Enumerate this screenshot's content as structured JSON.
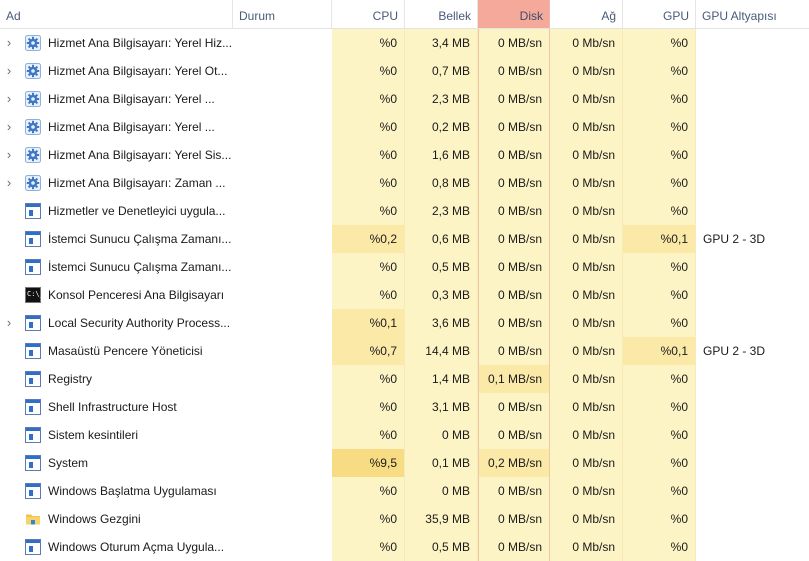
{
  "header": {
    "name": "Ad",
    "status": "Durum",
    "cpu": "CPU",
    "memory": "Bellek",
    "disk": "Disk",
    "network": "Ağ",
    "gpu": "GPU",
    "gpu_engine": "GPU Altyapısı"
  },
  "colors": {
    "light": "#fdf4c5",
    "medium": "#fbe9a8",
    "strong": "#f8dc83",
    "disk_header": "#f4a99a"
  },
  "rows": [
    {
      "name": "Hizmet Ana Bilgisayarı: Yerel Hiz...",
      "icon": "gear-icon",
      "expand": true,
      "cpu": "%0",
      "memory": "3,4 MB",
      "disk": "0 MB/sn",
      "network": "0 Mb/sn",
      "gpu": "%0",
      "engine": ""
    },
    {
      "name": "Hizmet Ana Bilgisayarı: Yerel Ot...",
      "icon": "gear-icon",
      "expand": true,
      "cpu": "%0",
      "memory": "0,7 MB",
      "disk": "0 MB/sn",
      "network": "0 Mb/sn",
      "gpu": "%0",
      "engine": ""
    },
    {
      "name": "Hizmet Ana Bilgisayarı: Yerel ...",
      "icon": "gear-icon",
      "expand": true,
      "cpu": "%0",
      "memory": "2,3 MB",
      "disk": "0 MB/sn",
      "network": "0 Mb/sn",
      "gpu": "%0",
      "engine": ""
    },
    {
      "name": "Hizmet Ana Bilgisayarı: Yerel ...",
      "icon": "gear-icon",
      "expand": true,
      "cpu": "%0",
      "memory": "0,2 MB",
      "disk": "0 MB/sn",
      "network": "0 Mb/sn",
      "gpu": "%0",
      "engine": ""
    },
    {
      "name": "Hizmet Ana Bilgisayarı: Yerel Sis...",
      "icon": "gear-icon",
      "expand": true,
      "cpu": "%0",
      "memory": "1,6 MB",
      "disk": "0 MB/sn",
      "network": "0 Mb/sn",
      "gpu": "%0",
      "engine": ""
    },
    {
      "name": "Hizmet Ana Bilgisayarı: Zaman ...",
      "icon": "gear-icon",
      "expand": true,
      "cpu": "%0",
      "memory": "0,8 MB",
      "disk": "0 MB/sn",
      "network": "0 Mb/sn",
      "gpu": "%0",
      "engine": ""
    },
    {
      "name": "Hizmetler ve Denetleyici uygula...",
      "icon": "window-app-icon",
      "expand": false,
      "cpu": "%0",
      "memory": "2,3 MB",
      "disk": "0 MB/sn",
      "network": "0 Mb/sn",
      "gpu": "%0",
      "engine": ""
    },
    {
      "name": "İstemci Sunucu Çalışma Zamanı...",
      "icon": "window-app-icon",
      "expand": false,
      "cpu": "%0,2",
      "memory": "0,6 MB",
      "disk": "0 MB/sn",
      "network": "0 Mb/sn",
      "gpu": "%0,1",
      "engine": "GPU 2 - 3D",
      "hl_cpu": "medium",
      "hl_gpu": "medium"
    },
    {
      "name": "İstemci Sunucu Çalışma Zamanı...",
      "icon": "window-app-icon",
      "expand": false,
      "cpu": "%0",
      "memory": "0,5 MB",
      "disk": "0 MB/sn",
      "network": "0 Mb/sn",
      "gpu": "%0",
      "engine": ""
    },
    {
      "name": "Konsol Penceresi Ana Bilgisayarı",
      "icon": "console-icon",
      "expand": false,
      "cpu": "%0",
      "memory": "0,3 MB",
      "disk": "0 MB/sn",
      "network": "0 Mb/sn",
      "gpu": "%0",
      "engine": ""
    },
    {
      "name": "Local Security Authority Process...",
      "icon": "window-app-icon",
      "expand": true,
      "cpu": "%0,1",
      "memory": "3,6 MB",
      "disk": "0 MB/sn",
      "network": "0 Mb/sn",
      "gpu": "%0",
      "engine": "",
      "hl_cpu": "medium"
    },
    {
      "name": "Masaüstü Pencere Yöneticisi",
      "icon": "window-app-icon",
      "expand": false,
      "cpu": "%0,7",
      "memory": "14,4 MB",
      "disk": "0 MB/sn",
      "network": "0 Mb/sn",
      "gpu": "%0,1",
      "engine": "GPU 2 - 3D",
      "hl_cpu": "medium",
      "hl_gpu": "medium"
    },
    {
      "name": "Registry",
      "icon": "window-app-icon",
      "expand": false,
      "cpu": "%0",
      "memory": "1,4 MB",
      "disk": "0,1 MB/sn",
      "network": "0 Mb/sn",
      "gpu": "%0",
      "engine": "",
      "hl_disk": "medium"
    },
    {
      "name": "Shell Infrastructure Host",
      "icon": "window-app-icon",
      "expand": false,
      "cpu": "%0",
      "memory": "3,1 MB",
      "disk": "0 MB/sn",
      "network": "0 Mb/sn",
      "gpu": "%0",
      "engine": ""
    },
    {
      "name": "Sistem kesintileri",
      "icon": "window-app-icon",
      "expand": false,
      "cpu": "%0",
      "memory": "0 MB",
      "disk": "0 MB/sn",
      "network": "0 Mb/sn",
      "gpu": "%0",
      "engine": ""
    },
    {
      "name": "System",
      "icon": "window-app-icon",
      "expand": false,
      "cpu": "%9,5",
      "memory": "0,1 MB",
      "disk": "0,2 MB/sn",
      "network": "0 Mb/sn",
      "gpu": "%0",
      "engine": "",
      "hl_cpu": "strong",
      "hl_disk": "medium"
    },
    {
      "name": "Windows Başlatma Uygulaması",
      "icon": "window-app-icon",
      "expand": false,
      "cpu": "%0",
      "memory": "0 MB",
      "disk": "0 MB/sn",
      "network": "0 Mb/sn",
      "gpu": "%0",
      "engine": ""
    },
    {
      "name": "Windows Gezgini",
      "icon": "folder-icon",
      "expand": false,
      "cpu": "%0",
      "memory": "35,9 MB",
      "disk": "0 MB/sn",
      "network": "0 Mb/sn",
      "gpu": "%0",
      "engine": ""
    },
    {
      "name": "Windows Oturum Açma Uygula...",
      "icon": "window-app-icon",
      "expand": false,
      "cpu": "%0",
      "memory": "0,5 MB",
      "disk": "0 MB/sn",
      "network": "0 Mb/sn",
      "gpu": "%0",
      "engine": ""
    }
  ]
}
